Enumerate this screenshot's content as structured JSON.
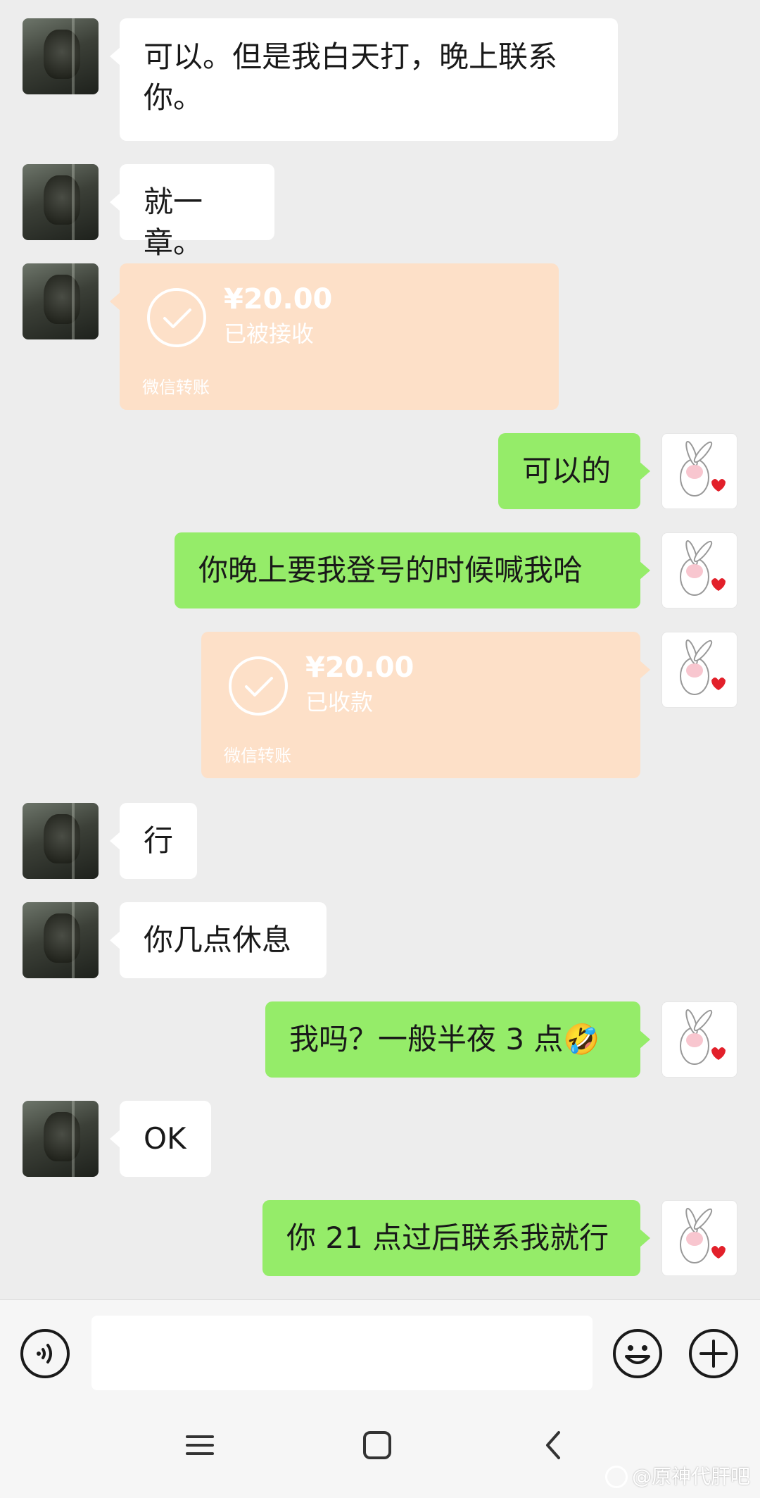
{
  "messages": [
    {
      "side": "in",
      "text": "可以。但是我白天打，晚上联系你。"
    },
    {
      "side": "in",
      "text": "就一章。"
    },
    {
      "side": "in",
      "type": "transfer",
      "amount": "¥20.00",
      "status": "已被接收",
      "footer": "微信转账"
    },
    {
      "side": "out",
      "text": "可以的"
    },
    {
      "side": "out",
      "text": "你晚上要我登号的时候喊我哈"
    },
    {
      "side": "out",
      "type": "transfer",
      "amount": "¥20.00",
      "status": "已收款",
      "footer": "微信转账"
    },
    {
      "side": "in",
      "text": "行"
    },
    {
      "side": "in",
      "text": "你几点休息"
    },
    {
      "side": "out",
      "text": "我吗？一般半夜 3 点🤣"
    },
    {
      "side": "in",
      "text": "OK"
    },
    {
      "side": "out",
      "text": "你 21 点过后联系我就行"
    }
  ],
  "input": {
    "value": "",
    "placeholder": ""
  },
  "icons": {
    "voice": "voice-icon",
    "emoji": "emoji-icon",
    "more": "plus-icon",
    "nav_menu": "menu-icon",
    "nav_home": "home-icon",
    "nav_back": "back-icon",
    "weibo": "weibo-icon",
    "check": "check-icon"
  },
  "watermark": {
    "text": "@原神代肝吧"
  },
  "colors": {
    "background": "#ededed",
    "incoming_bubble": "#ffffff",
    "outgoing_bubble": "#95ec69",
    "transfer_card": "#fde0c8",
    "input_bar": "#f6f6f6"
  }
}
